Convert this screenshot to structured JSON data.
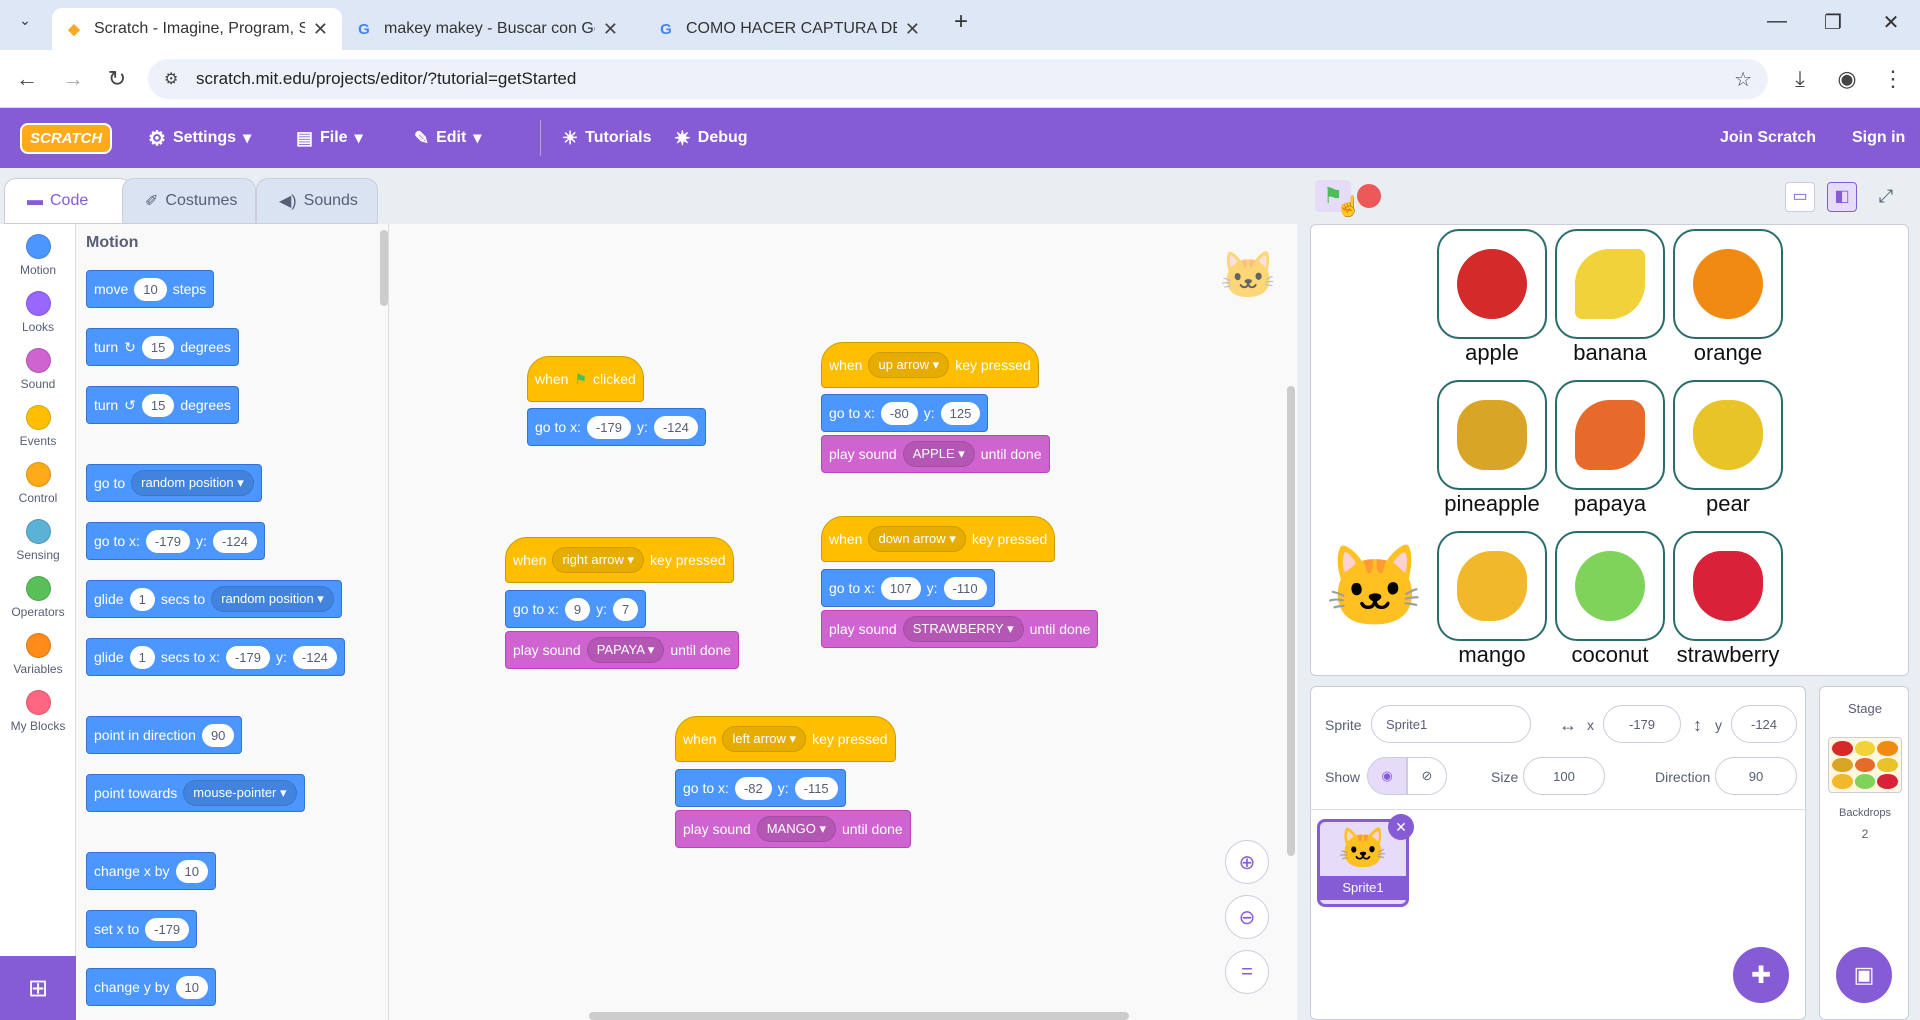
{
  "browser": {
    "tabs": [
      {
        "title": "Scratch - Imagine, Program, Sh"
      },
      {
        "title": "makey makey - Buscar con Goo"
      },
      {
        "title": "COMO HACER CAPTURA DE PA"
      }
    ],
    "url": "scratch.mit.edu/projects/editor/?tutorial=getStarted"
  },
  "menubar": {
    "logo": "SCRATCH",
    "settings": "Settings",
    "file": "File",
    "edit": "Edit",
    "tutorials": "Tutorials",
    "debug": "Debug",
    "join": "Join Scratch",
    "signin": "Sign in"
  },
  "editor_tabs": {
    "code": "Code",
    "costumes": "Costumes",
    "sounds": "Sounds"
  },
  "categories": [
    {
      "label": "Motion",
      "color": "#4c97ff"
    },
    {
      "label": "Looks",
      "color": "#9966ff"
    },
    {
      "label": "Sound",
      "color": "#cf63cf"
    },
    {
      "label": "Events",
      "color": "#ffbf00"
    },
    {
      "label": "Control",
      "color": "#ffab19"
    },
    {
      "label": "Sensing",
      "color": "#5cb1d6"
    },
    {
      "label": "Operators",
      "color": "#59c059"
    },
    {
      "label": "Variables",
      "color": "#ff8c1a"
    },
    {
      "label": "My Blocks",
      "color": "#ff6680"
    }
  ],
  "palette": {
    "heading": "Motion",
    "move": {
      "a": "move",
      "v": "10",
      "b": "steps"
    },
    "turn_r": {
      "a": "turn",
      "v": "15",
      "b": "degrees"
    },
    "turn_l": {
      "a": "turn",
      "v": "15",
      "b": "degrees"
    },
    "goto": {
      "a": "go to",
      "d": "random position"
    },
    "gotoxy": {
      "a": "go to x:",
      "x": "-179",
      "b": "y:",
      "y": "-124"
    },
    "glide1": {
      "a": "glide",
      "v": "1",
      "b": "secs to",
      "d": "random position"
    },
    "glide2": {
      "a": "glide",
      "v": "1",
      "b": "secs to x:",
      "x": "-179",
      "c": "y:",
      "y": "-124"
    },
    "point_dir": {
      "a": "point in direction",
      "v": "90"
    },
    "point_towards": {
      "a": "point towards",
      "d": "mouse-pointer"
    },
    "change_x": {
      "a": "change x by",
      "v": "10"
    },
    "set_x": {
      "a": "set x to",
      "v": "-179"
    },
    "change_y": {
      "a": "change y by",
      "v": "10"
    }
  },
  "scripts": {
    "flag": {
      "when": "when",
      "clicked": "clicked",
      "goto": "go to x:",
      "x": "-179",
      "y_lbl": "y:",
      "y": "-124"
    },
    "up": {
      "when": "when",
      "key": "up arrow",
      "pressed": "key pressed",
      "goto": "go to x:",
      "x": "-80",
      "y_lbl": "y:",
      "y": "125",
      "play": "play sound",
      "sound": "APPLE",
      "until": "until done"
    },
    "right": {
      "when": "when",
      "key": "right arrow",
      "pressed": "key pressed",
      "goto": "go to x:",
      "x": "9",
      "y_lbl": "y:",
      "y": "7",
      "play": "play sound",
      "sound": "PAPAYA",
      "until": "until done"
    },
    "down": {
      "when": "when",
      "key": "down arrow",
      "pressed": "key pressed",
      "goto": "go to x:",
      "x": "107",
      "y_lbl": "y:",
      "y": "-110",
      "play": "play sound",
      "sound": "STRAWBERRY",
      "until": "until done"
    },
    "left": {
      "when": "when",
      "key": "left arrow",
      "pressed": "key pressed",
      "goto": "go to x:",
      "x": "-82",
      "y_lbl": "y:",
      "y": "-115",
      "play": "play sound",
      "sound": "MANGO",
      "until": "until done"
    }
  },
  "stage": {
    "fruits": [
      {
        "label": "apple",
        "color": "#d42a2a"
      },
      {
        "label": "banana",
        "color": "#f1d23a"
      },
      {
        "label": "orange",
        "color": "#f18a12"
      },
      {
        "label": "pineapple",
        "color": "#d9a526"
      },
      {
        "label": "papaya",
        "color": "#e86a2a"
      },
      {
        "label": "pear",
        "color": "#e8c428"
      },
      {
        "label": "mango",
        "color": "#f0b82a"
      },
      {
        "label": "coconut",
        "color": "#7fd35a"
      },
      {
        "label": "strawberry",
        "color": "#d9223a"
      }
    ]
  },
  "sprite_info": {
    "sprite_lbl": "Sprite",
    "name": "Sprite1",
    "x_lbl": "x",
    "x": "-179",
    "y_lbl": "y",
    "y": "-124",
    "show_lbl": "Show",
    "size_lbl": "Size",
    "size": "100",
    "dir_lbl": "Direction",
    "dir": "90",
    "thumb_name": "Sprite1"
  },
  "stage_pane": {
    "title": "Stage",
    "backdrops_lbl": "Backdrops",
    "backdrops": "2"
  }
}
